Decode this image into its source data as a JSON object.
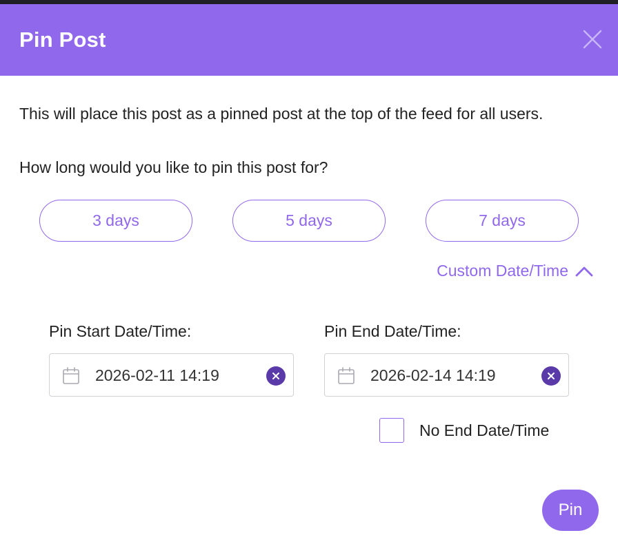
{
  "modal": {
    "title": "Pin Post",
    "description": "This will place this post as a pinned post at the top of the feed for all users.",
    "question": "How long would you like to pin this post for?"
  },
  "presets": [
    {
      "label": "3 days"
    },
    {
      "label": "5 days"
    },
    {
      "label": "7 days"
    }
  ],
  "custom": {
    "toggle_label": "Custom Date/Time",
    "start_label": "Pin Start Date/Time:",
    "start_value": "2026-02-11 14:19",
    "end_label": "Pin End Date/Time:",
    "end_value": "2026-02-14 14:19",
    "no_end_label": "No End Date/Time",
    "no_end_checked": false
  },
  "actions": {
    "pin_label": "Pin"
  },
  "icons": {
    "close": "close-icon",
    "chevron": "chevron-up-icon",
    "calendar": "calendar-icon",
    "clear": "clear-icon"
  },
  "colors": {
    "accent": "#9068ec",
    "clear_button": "#5a3aa8",
    "text": "#222222"
  }
}
